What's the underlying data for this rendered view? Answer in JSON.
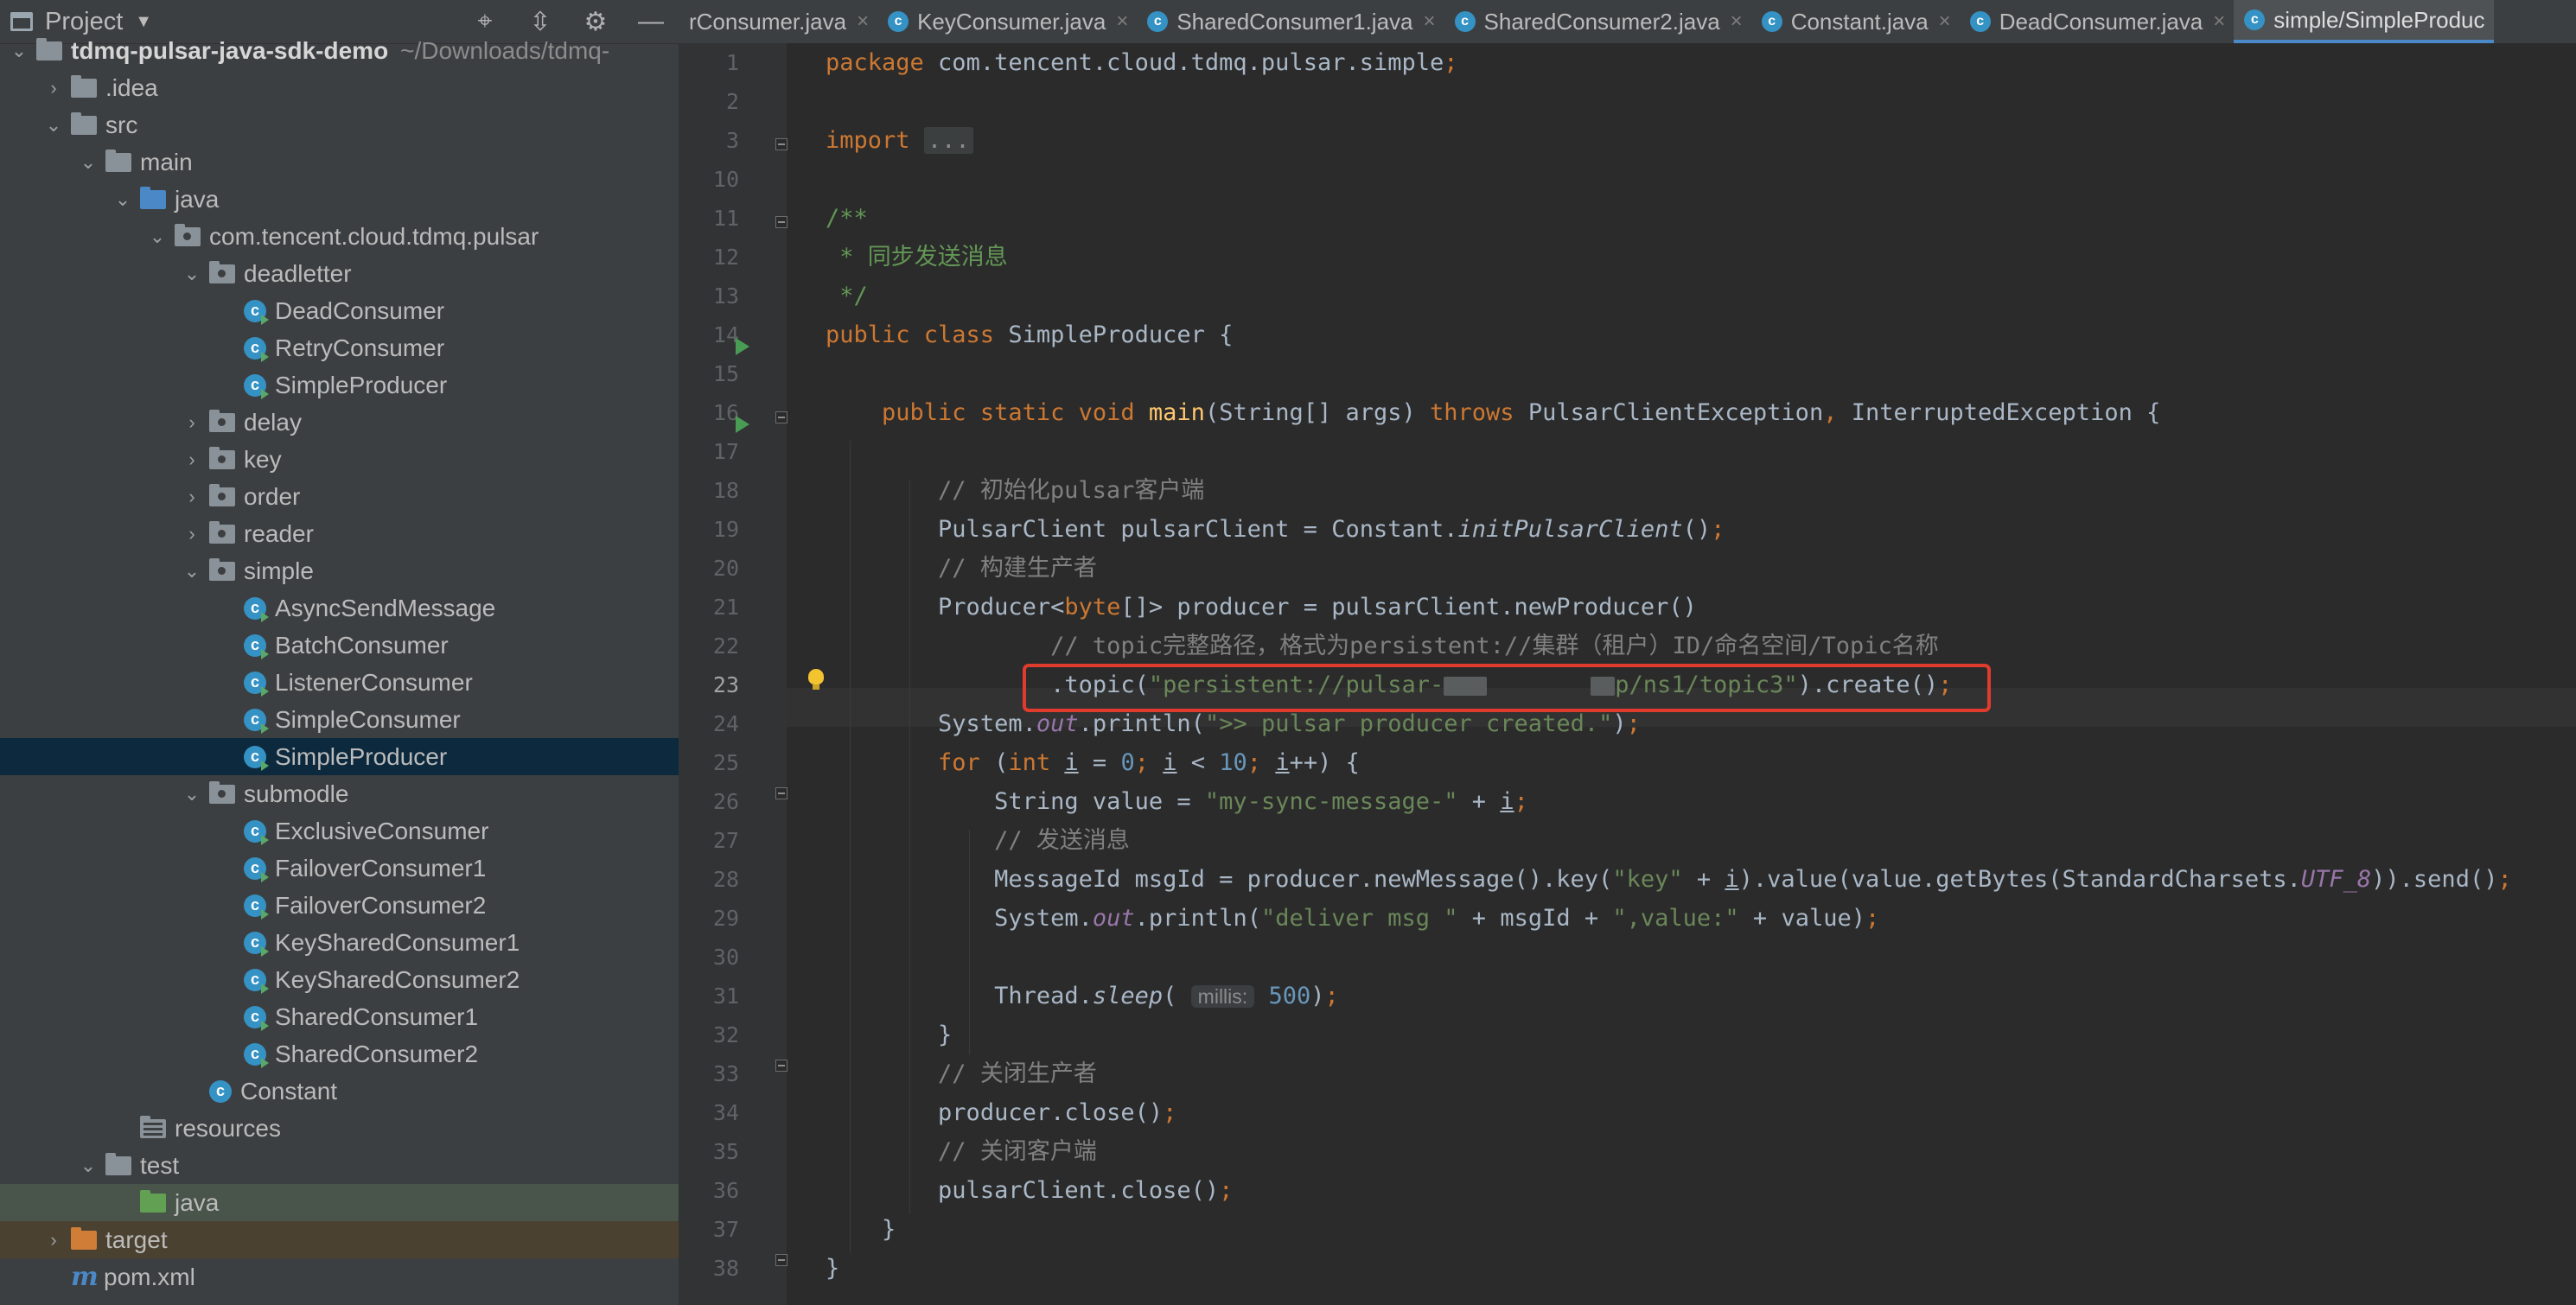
{
  "project": {
    "title": "Project",
    "tree": [
      {
        "label": "tdmq-pulsar-java-sdk-demo",
        "hint": "~/Downloads/tdmq-",
        "depth": 0,
        "arrow": "down",
        "icon": "folder",
        "bold": true
      },
      {
        "label": ".idea",
        "depth": 1,
        "arrow": "right",
        "icon": "folder"
      },
      {
        "label": "src",
        "depth": 1,
        "arrow": "down",
        "icon": "folder"
      },
      {
        "label": "main",
        "depth": 2,
        "arrow": "down",
        "icon": "folder"
      },
      {
        "label": "java",
        "depth": 3,
        "arrow": "down",
        "icon": "folder-blue"
      },
      {
        "label": "com.tencent.cloud.tdmq.pulsar",
        "depth": 4,
        "arrow": "down",
        "icon": "package"
      },
      {
        "label": "deadletter",
        "depth": 5,
        "arrow": "down",
        "icon": "package"
      },
      {
        "label": "DeadConsumer",
        "depth": 6,
        "arrow": "none",
        "icon": "class-run"
      },
      {
        "label": "RetryConsumer",
        "depth": 6,
        "arrow": "none",
        "icon": "class-run"
      },
      {
        "label": "SimpleProducer",
        "depth": 6,
        "arrow": "none",
        "icon": "class-run"
      },
      {
        "label": "delay",
        "depth": 5,
        "arrow": "right",
        "icon": "package"
      },
      {
        "label": "key",
        "depth": 5,
        "arrow": "right",
        "icon": "package"
      },
      {
        "label": "order",
        "depth": 5,
        "arrow": "right",
        "icon": "package"
      },
      {
        "label": "reader",
        "depth": 5,
        "arrow": "right",
        "icon": "package"
      },
      {
        "label": "simple",
        "depth": 5,
        "arrow": "down",
        "icon": "package"
      },
      {
        "label": "AsyncSendMessage",
        "depth": 6,
        "arrow": "none",
        "icon": "class-run"
      },
      {
        "label": "BatchConsumer",
        "depth": 6,
        "arrow": "none",
        "icon": "class-run"
      },
      {
        "label": "ListenerConsumer",
        "depth": 6,
        "arrow": "none",
        "icon": "class-run"
      },
      {
        "label": "SimpleConsumer",
        "depth": 6,
        "arrow": "none",
        "icon": "class-run"
      },
      {
        "label": "SimpleProducer",
        "depth": 6,
        "arrow": "none",
        "icon": "class-run",
        "selected": true
      },
      {
        "label": "submodle",
        "depth": 5,
        "arrow": "down",
        "icon": "package"
      },
      {
        "label": "ExclusiveConsumer",
        "depth": 6,
        "arrow": "none",
        "icon": "class-run"
      },
      {
        "label": "FailoverConsumer1",
        "depth": 6,
        "arrow": "none",
        "icon": "class-run"
      },
      {
        "label": "FailoverConsumer2",
        "depth": 6,
        "arrow": "none",
        "icon": "class-run"
      },
      {
        "label": "KeySharedConsumer1",
        "depth": 6,
        "arrow": "none",
        "icon": "class-run"
      },
      {
        "label": "KeySharedConsumer2",
        "depth": 6,
        "arrow": "none",
        "icon": "class-run"
      },
      {
        "label": "SharedConsumer1",
        "depth": 6,
        "arrow": "none",
        "icon": "class-run"
      },
      {
        "label": "SharedConsumer2",
        "depth": 6,
        "arrow": "none",
        "icon": "class-run"
      },
      {
        "label": "Constant",
        "depth": 5,
        "arrow": "none",
        "icon": "class"
      },
      {
        "label": "resources",
        "depth": 3,
        "arrow": "none",
        "icon": "folder-res"
      },
      {
        "label": "test",
        "depth": 2,
        "arrow": "down",
        "icon": "folder"
      },
      {
        "label": "java",
        "depth": 3,
        "arrow": "none",
        "icon": "folder-green",
        "rowclass": "test-sel"
      },
      {
        "label": "target",
        "depth": 1,
        "arrow": "right",
        "icon": "folder-orange",
        "rowclass": "target-row"
      },
      {
        "label": "pom.xml",
        "depth": 1,
        "arrow": "none",
        "icon": "maven"
      }
    ]
  },
  "tabs": [
    {
      "label": "rConsumer.java",
      "icon": false
    },
    {
      "label": "KeyConsumer.java",
      "icon": true
    },
    {
      "label": "SharedConsumer1.java",
      "icon": true
    },
    {
      "label": "SharedConsumer2.java",
      "icon": true
    },
    {
      "label": "Constant.java",
      "icon": true
    },
    {
      "label": "DeadConsumer.java",
      "icon": true
    },
    {
      "label": "simple/SimpleProduc",
      "icon": true,
      "active": true
    }
  ],
  "editor": {
    "line_numbers": [
      "1",
      "2",
      "3",
      "10",
      "11",
      "12",
      "13",
      "14",
      "15",
      "16",
      "17",
      "18",
      "19",
      "20",
      "21",
      "22",
      "23",
      "24",
      "25",
      "26",
      "27",
      "28",
      "29",
      "30",
      "31",
      "32",
      "33",
      "34",
      "35",
      "36",
      "37",
      "38"
    ],
    "current_line": "23",
    "code": {
      "pkg_kw": "package",
      "pkg_name": " com.tencent.cloud.tdmq.pulsar.simple",
      "import_kw": "import",
      "import_fold": "...",
      "doc_open": "/**",
      "doc_text": " * 同步发送消息",
      "doc_close": " */",
      "class_decl_kw": "public class",
      "class_name": " SimpleProducer {",
      "main_kw": "public static void",
      "main_name": "main",
      "main_params": "(String[] args) ",
      "throws_kw": "throws",
      "main_exc": " PulsarClientException",
      "main_exc2": " InterruptedException {",
      "c_init": "// 初始化pulsar客户端",
      "l19a": "PulsarClient pulsarClient = Constant.",
      "l19b": "initPulsarClient",
      "l19c": "()",
      "c_build": "// 构建生产者",
      "l21a": "Producer<",
      "l21b": "byte",
      "l21c": "[]> producer = pulsarClient.newProducer()",
      "c_topic": "// topic完整路径，格式为persistent://集群（租户）ID/命名空间/Topic名称",
      "l23a": ".topic(",
      "l23s1": "\"persistent://pulsar-",
      "l23s2": "p/ns1/topic3\"",
      "l23b": ").create()",
      "l24a": "System.",
      "l24out": "out",
      "l24b": ".println(",
      "l24s": "\">> pulsar producer created.\"",
      "l24c": ")",
      "for_kw": "for",
      "int_kw": "int",
      "l25i": "i",
      "l25n0": "0",
      "l25n10": "10",
      "l26a": "String value = ",
      "l26s": "\"my-sync-message-\"",
      "c_send": "// 发送消息",
      "l28a": "MessageId msgId = producer.newMessage().key(",
      "l28s": "\"key\"",
      "l28b": ").value(value.getBytes(StandardCharsets.",
      "l28utf": "UTF_8",
      "l28c": ")).send()",
      "l29s1": "\"deliver msg \"",
      "l29mid": " + msgId + ",
      "l29s2": "\",value:\"",
      "l29end": " + value)",
      "l31a": "Thread.",
      "l31sleep": "sleep",
      "l31hint": "millis:",
      "l31n": "500",
      "c_close_p": "// 关闭生产者",
      "l34": "producer.close()",
      "c_close_c": "// 关闭客户端",
      "l36": "pulsarClient.close()",
      "brace": "}"
    }
  },
  "colors": {
    "keyword": "#cc7832",
    "string": "#6a8759",
    "number": "#6897bb",
    "comment": "#808080",
    "doc": "#629755",
    "function": "#ffc66d",
    "highlight_box": "#e03c2e"
  }
}
